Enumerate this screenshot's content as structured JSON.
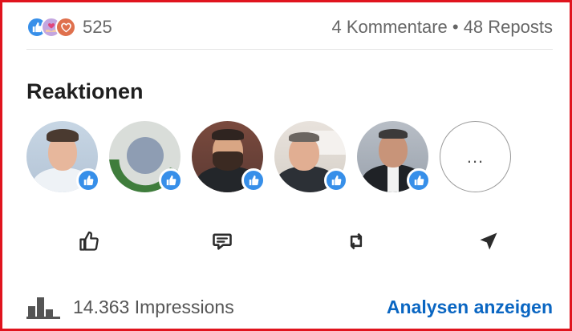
{
  "reactions": {
    "icons": [
      "like-icon",
      "support-icon",
      "love-icon"
    ],
    "count": "525"
  },
  "engagement": {
    "text": "4 Kommentare • 48 Reposts"
  },
  "reactions_section": {
    "title": "Reaktionen",
    "more_label": "..."
  },
  "actions": [
    "like-icon",
    "comment-icon",
    "repost-icon",
    "send-icon"
  ],
  "footer": {
    "impressions": "14.363 Impressions",
    "analytics_link": "Analysen anzeigen"
  },
  "colors": {
    "border": "#e0141e",
    "link": "#0a66c2",
    "like_blue": "#378fe9"
  }
}
